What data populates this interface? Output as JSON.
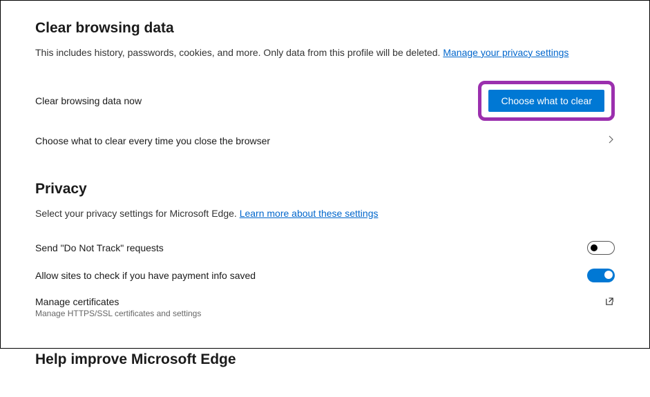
{
  "sections": {
    "clearData": {
      "title": "Clear browsing data",
      "description": "This includes history, passwords, cookies, and more. Only data from this profile will be deleted. ",
      "descriptionLink": "Manage your privacy settings",
      "rows": {
        "clearNow": {
          "label": "Clear browsing data now",
          "button": "Choose what to clear"
        },
        "clearOnClose": {
          "label": "Choose what to clear every time you close the browser"
        }
      }
    },
    "privacy": {
      "title": "Privacy",
      "description": "Select your privacy settings for Microsoft Edge. ",
      "descriptionLink": "Learn more about these settings",
      "rows": {
        "doNotTrack": {
          "label": "Send \"Do Not Track\" requests",
          "enabled": false
        },
        "paymentInfo": {
          "label": "Allow sites to check if you have payment info saved",
          "enabled": true
        },
        "certificates": {
          "label": "Manage certificates",
          "sublabel": "Manage HTTPS/SSL certificates and settings"
        }
      }
    },
    "helpImprove": {
      "title": "Help improve Microsoft Edge"
    }
  }
}
